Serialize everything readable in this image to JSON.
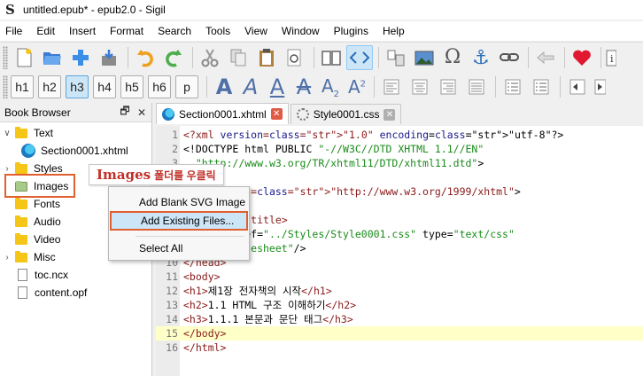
{
  "window": {
    "title": "untitled.epub* - epub2.0 - Sigil"
  },
  "menu": [
    "File",
    "Edit",
    "Insert",
    "Format",
    "Search",
    "Tools",
    "View",
    "Window",
    "Plugins",
    "Help"
  ],
  "heading_buttons": [
    "h1",
    "h2",
    "h3",
    "h4",
    "h5",
    "h6",
    "p"
  ],
  "book_browser": {
    "title": "Book Browser",
    "tree": [
      {
        "label": "Text",
        "kind": "folder"
      },
      {
        "label": "Section0001.xhtml",
        "kind": "file-edge"
      },
      {
        "label": "Styles",
        "kind": "folder"
      },
      {
        "label": "Images",
        "kind": "folder-img"
      },
      {
        "label": "Fonts",
        "kind": "folder"
      },
      {
        "label": "Audio",
        "kind": "folder"
      },
      {
        "label": "Video",
        "kind": "folder"
      },
      {
        "label": "Misc",
        "kind": "folder"
      },
      {
        "label": "toc.ncx",
        "kind": "file"
      },
      {
        "label": "content.opf",
        "kind": "file"
      }
    ]
  },
  "annotation": {
    "bold": "Images",
    "text": "폴더를 우클릭"
  },
  "context_menu": {
    "items": [
      "Add Blank SVG Image",
      "Add Existing Files...",
      "Select All"
    ],
    "selected": "Add Existing Files..."
  },
  "tabs": [
    {
      "label": "Section0001.xhtml",
      "active": true
    },
    {
      "label": "Style0001.css",
      "active": false
    }
  ],
  "code_lines": [
    "<?xml version=\"1.0\" encoding=\"utf-8\"?>",
    "<!DOCTYPE html PUBLIC \"-//W3C//DTD XHTML 1.1//EN\"",
    "  \"http://www.w3.org/TR/xhtml11/DTD/xhtml11.dtd\">",
    "",
    "<html xmlns=\"http://www.w3.org/1999/xhtml\">",
    "<head>",
    "  <title></title>",
    "  <link href=\"../Styles/Style0001.css\" type=\"text/css\"",
    "  rel=\"stylesheet\"/>",
    "</head>",
    "<body>",
    "<h1>제1장 전자책의 시작</h1>",
    "<h2>1.1 HTML 구조 이해하기</h2>",
    "<h3>1.1.1 본문과 문단 태그</h3>",
    "</body>",
    "</html>"
  ],
  "visible_code": [
    {
      "n": "1",
      "text": "<?xml version=\"1.0\" encoding=\"utf-8\"?>"
    },
    {
      "n": "2",
      "text": "<!DOCTYPE html PUBLIC \"-//W3C//DTD XHTML 1.1//EN\""
    },
    {
      "n": "3",
      "text": "  \"http://www.w3.org/TR/xhtml11/DTD/xhtml11.dtd\">"
    },
    {
      "n": "4",
      "text": ""
    },
    {
      "n": "5",
      "text": "<html xmlns=\"http://www.w3.org/1999/xhtml\">"
    },
    {
      "n": "6",
      "text": "<head>"
    },
    {
      "n": "7",
      "text": "  <title></title>"
    },
    {
      "n": "8",
      "text": "  <link href=\"../Styles/Style0001.css\" type=\"text/css\""
    },
    {
      "n": "9",
      "text": "  rel=\"stylesheet\"/>"
    },
    {
      "n": "10",
      "text": "</head>"
    },
    {
      "n": "11",
      "text": "<body>"
    },
    {
      "n": "12",
      "text": "<h1>제1장 전자책의 시작</h1>"
    },
    {
      "n": "13",
      "text": "<h2>1.1 HTML 구조 이해하기</h2>"
    },
    {
      "n": "14",
      "text": "<h3>1.1.1 본문과 문단 태그</h3>"
    },
    {
      "n": "15",
      "text": "</body>"
    },
    {
      "n": "16",
      "text": "</html>"
    }
  ],
  "colors": {
    "accent": "#e06030",
    "selection": "#cde6f7",
    "current_line": "#ffffc8"
  }
}
